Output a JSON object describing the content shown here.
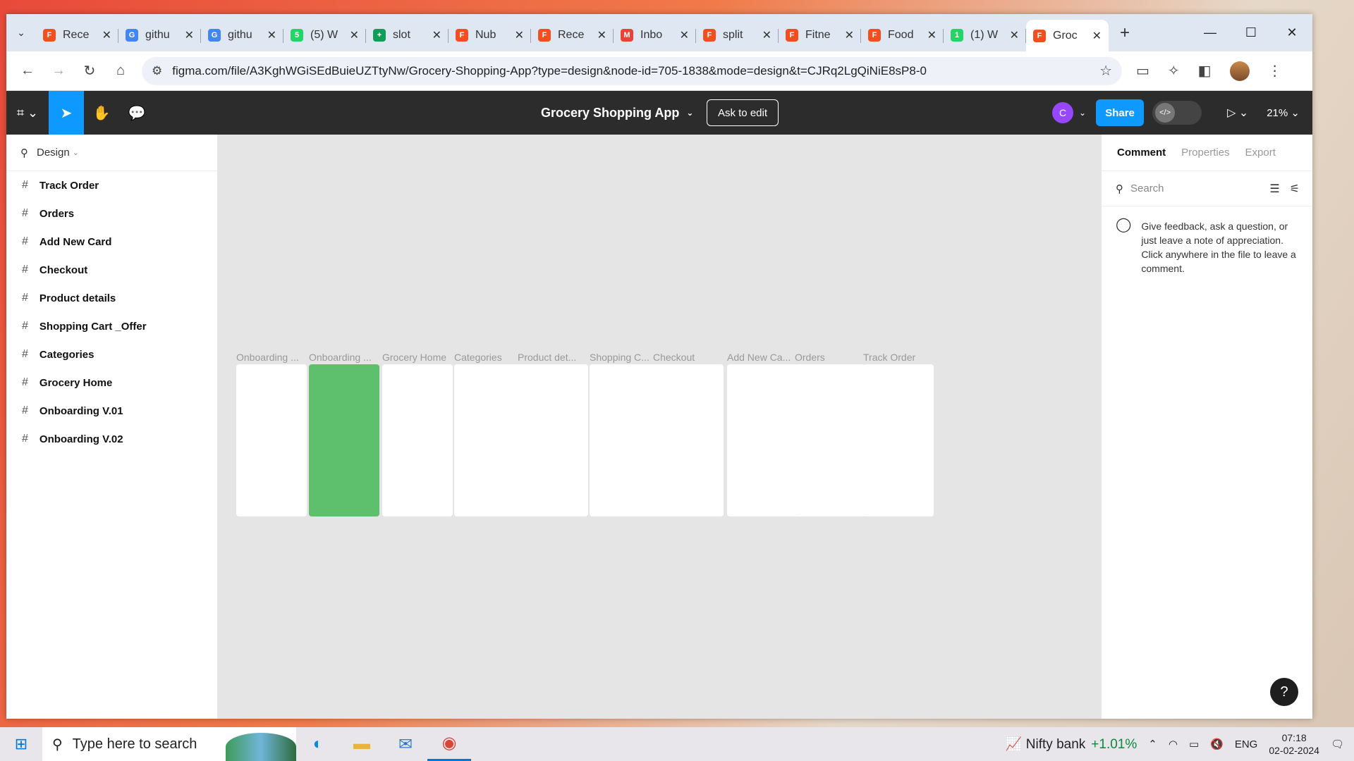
{
  "browser": {
    "tabs": [
      {
        "title": "Rece",
        "favicon": "figma-icon",
        "color": "#f24e1e",
        "glyph": "F"
      },
      {
        "title": "githu",
        "favicon": "google-icon",
        "color": "#4285f4",
        "glyph": "G"
      },
      {
        "title": "githu",
        "favicon": "google-icon",
        "color": "#4285f4",
        "glyph": "G"
      },
      {
        "title": "(5) W",
        "favicon": "whatsapp-icon",
        "color": "#25d366",
        "glyph": "5"
      },
      {
        "title": "slot",
        "favicon": "sheets-icon",
        "color": "#0f9d58",
        "glyph": "+"
      },
      {
        "title": "Nub",
        "favicon": "figma-icon",
        "color": "#f24e1e",
        "glyph": "F"
      },
      {
        "title": "Rece",
        "favicon": "figma-icon",
        "color": "#f24e1e",
        "glyph": "F"
      },
      {
        "title": "Inbo",
        "favicon": "gmail-icon",
        "color": "#ea4335",
        "glyph": "M"
      },
      {
        "title": "split",
        "favicon": "figma-icon",
        "color": "#f24e1e",
        "glyph": "F"
      },
      {
        "title": "Fitne",
        "favicon": "figma-icon",
        "color": "#f24e1e",
        "glyph": "F"
      },
      {
        "title": "Food",
        "favicon": "figma-icon",
        "color": "#f24e1e",
        "glyph": "F"
      },
      {
        "title": "(1) W",
        "favicon": "whatsapp-icon",
        "color": "#25d366",
        "glyph": "1"
      },
      {
        "title": "Groc",
        "favicon": "figma-icon",
        "color": "#f24e1e",
        "glyph": "F",
        "active": true
      }
    ],
    "url": "figma.com/file/A3KghWGiSEdBuieUZTtyNw/Grocery-Shopping-App?type=design&node-id=705-1838&mode=design&t=CJRq2LgQiNiE8sP8-0"
  },
  "figma": {
    "file_title": "Grocery Shopping App",
    "ask_to_edit": "Ask to edit",
    "avatar_letter": "C",
    "share_label": "Share",
    "zoom": "21%",
    "left_panel": {
      "mode_label": "Design",
      "layers": [
        "Track Order",
        "Orders",
        "Add New Card",
        "Checkout",
        "Product details",
        "Shopping Cart _Offer",
        "Categories",
        "Grocery Home",
        "Onboarding V.01",
        "Onboarding V.02"
      ]
    },
    "frames": [
      {
        "label": "Onboarding ...",
        "style": "white"
      },
      {
        "label": "Onboarding ...",
        "style": "green"
      },
      {
        "label": "Grocery Home",
        "style": "white"
      },
      {
        "label": "Categories",
        "style": "white"
      },
      {
        "label": "Product det...",
        "style": "white"
      },
      {
        "label": "Shopping C...",
        "style": "white"
      },
      {
        "label": "Checkout",
        "style": "white"
      },
      {
        "label": "Add New Ca...",
        "style": "white"
      },
      {
        "label": "Orders",
        "style": "white"
      },
      {
        "label": "Track Order",
        "style": "white"
      }
    ],
    "right_panel": {
      "tabs": [
        "Comment",
        "Properties",
        "Export"
      ],
      "search_placeholder": "Search",
      "note": "Give feedback, ask a question, or just leave a note of appreciation. Click anywhere in the file to leave a comment."
    },
    "accent_color": "#0d99ff"
  },
  "taskbar": {
    "search_placeholder": "Type here to search",
    "stock_name": "Nifty bank",
    "stock_change": "+1.01%",
    "lang": "ENG",
    "time": "07:18",
    "date": "02-02-2024"
  }
}
